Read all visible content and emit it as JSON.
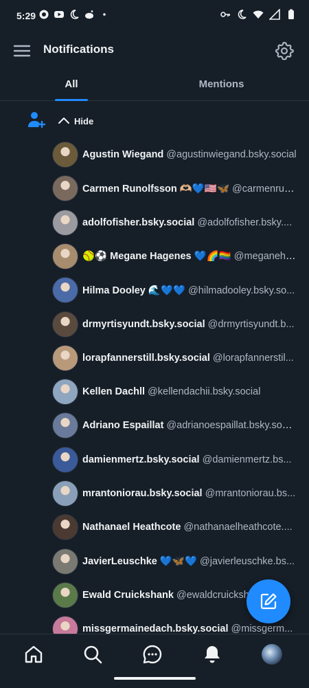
{
  "status_bar": {
    "time": "5:29"
  },
  "header": {
    "title": "Notifications"
  },
  "tabs": [
    {
      "label": "All"
    },
    {
      "label": "Mentions"
    }
  ],
  "group": {
    "hide_label": "Hide"
  },
  "colors": {
    "accent": "#208bfe",
    "background": "#161e27",
    "secondary_text": "#aeb8c4"
  },
  "users": [
    {
      "name": "Agustin Wiegand",
      "handle": "@agustinwiegand.bsky.social",
      "avatar_color": "#6b5b3a"
    },
    {
      "name": "Carmen Runolfsson 🫶🏼💙🇺🇸🦋",
      "handle": "@carmenrun...",
      "avatar_color": "#7a6a5e"
    },
    {
      "name": "adolfofisher.bsky.social",
      "handle": "@adolfofisher.bsky....",
      "avatar_color": "#9a9aa0"
    },
    {
      "name": "🥎⚽ Megane Hagenes 💙🌈🏳️‍🌈",
      "handle": "@meganeha...",
      "avatar_color": "#a88c6e"
    },
    {
      "name": "Hilma Dooley 🌊💙💙",
      "handle": "@hilmadooley.bsky.so...",
      "avatar_color": "#4a6aa8"
    },
    {
      "name": "drmyrtisyundt.bsky.social",
      "handle": "@drmyrtisyundt.b...",
      "avatar_color": "#5a4a3e"
    },
    {
      "name": "lorapfannerstill.bsky.social",
      "handle": "@lorapfannerstil...",
      "avatar_color": "#b89a7a"
    },
    {
      "name": "Kellen Dachll",
      "handle": "@kellendachii.bsky.social",
      "avatar_color": "#8ea6c0"
    },
    {
      "name": "Adriano Espaillat",
      "handle": "@adrianoespaillat.bsky.social",
      "avatar_color": "#6a7a9a"
    },
    {
      "name": "damienmertz.bsky.social",
      "handle": "@damienmertz.bs...",
      "avatar_color": "#3a5a9a"
    },
    {
      "name": "mrantoniorau.bsky.social",
      "handle": "@mrantoniorau.bs...",
      "avatar_color": "#8aa0b8"
    },
    {
      "name": "Nathanael Heathcote",
      "handle": "@nathanaelheathcote....",
      "avatar_color": "#4a3a32"
    },
    {
      "name": "JavierLeuschke 💙🦋💙",
      "handle": "@javierleuschke.bs...",
      "avatar_color": "#7a7a72"
    },
    {
      "name": "Ewald Cruickshank",
      "handle": "@ewaldcruicksh...",
      "avatar_color": "#5a7a4a"
    },
    {
      "name": "missgermainedach.bsky.social",
      "handle": "@missgerm...",
      "avatar_color": "#c87a9a"
    }
  ],
  "icons": {
    "menu": "menu-icon",
    "settings": "gear-icon",
    "follow": "user-plus-icon",
    "chevron": "chevron-up-icon",
    "compose": "compose-icon",
    "home": "home-icon",
    "search": "search-icon",
    "chat": "chat-icon",
    "bell": "bell-icon"
  }
}
